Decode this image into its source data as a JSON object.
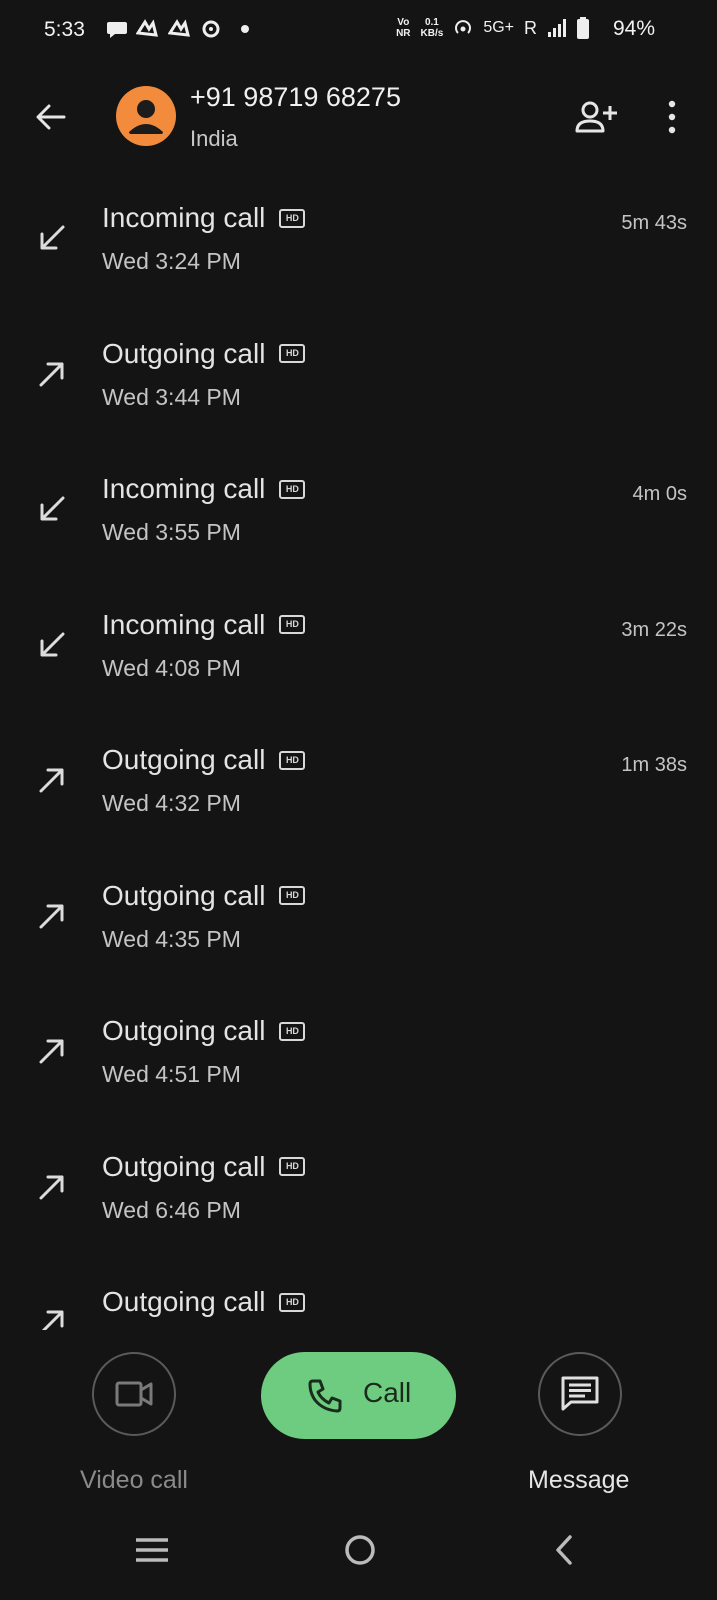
{
  "status_bar": {
    "time": "5:33",
    "volte_top": "Vo",
    "volte_bottom": "NR",
    "speed_value": "0.1",
    "speed_unit": "KB/s",
    "network": "5G+",
    "roaming": "R",
    "battery_pct": "94%"
  },
  "header": {
    "title": "+91 98719 68275",
    "subtitle": "India",
    "back_icon": "arrow-left-icon",
    "add_contact_icon": "person-add-icon",
    "more_icon": "more-vert-icon"
  },
  "calls": [
    {
      "label": "Incoming call",
      "time": "Wed 3:24 PM",
      "duration": "5m 43s",
      "direction": "incoming"
    },
    {
      "label": "Outgoing call",
      "time": "Wed 3:44 PM",
      "duration": "",
      "direction": "outgoing"
    },
    {
      "label": "Incoming call",
      "time": "Wed 3:55 PM",
      "duration": "4m 0s",
      "direction": "incoming"
    },
    {
      "label": "Incoming call",
      "time": "Wed 4:08 PM",
      "duration": "3m 22s",
      "direction": "incoming"
    },
    {
      "label": "Outgoing call",
      "time": "Wed 4:32 PM",
      "duration": "1m 38s",
      "direction": "outgoing"
    },
    {
      "label": "Outgoing call",
      "time": "Wed 4:35 PM",
      "duration": "",
      "direction": "outgoing"
    },
    {
      "label": "Outgoing call",
      "time": "Wed 4:51 PM",
      "duration": "",
      "direction": "outgoing"
    },
    {
      "label": "Outgoing call",
      "time": "Wed 6:46 PM",
      "duration": "",
      "direction": "outgoing"
    },
    {
      "label": "Outgoing call",
      "time": "",
      "duration": "",
      "direction": "outgoing"
    }
  ],
  "hd_badge": "HD",
  "actions": {
    "video_label": "Video call",
    "call_label": "Call",
    "message_label": "Message"
  },
  "colors": {
    "background": "#141414",
    "call_button": "#6dcc7f",
    "avatar": "#f28c3c"
  }
}
